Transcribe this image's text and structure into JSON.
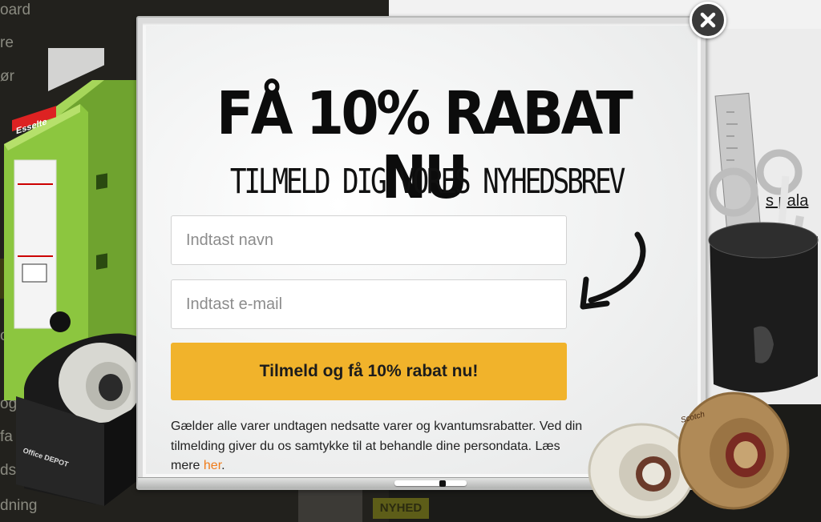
{
  "background": {
    "left_menu_items": [
      "oard",
      "re",
      "ør",
      "obb",
      "og",
      "fa",
      "ds",
      "dning"
    ],
    "right_link": "s pala",
    "badge": "NYHED"
  },
  "popup": {
    "headline": "FÅ 10% RABAT NU",
    "subheadline": "TILMELD DIG VORES NYHEDSBREV",
    "name_placeholder": "Indtast navn",
    "email_placeholder": "Indtast e-mail",
    "submit_label": "Tilmeld og få 10% rabat nu!",
    "disclaimer_text": "Gælder alle varer undtagen nedsatte varer og kvantumsrabatter. Ved din tilmelding giver du os samtykke til at behandle dine persondata. Læs mere ",
    "disclaimer_link": "her",
    "disclaimer_end": "."
  },
  "decor": {
    "binder_brand": "Esselte",
    "dispenser_brand": "Office DEPOT",
    "tape_brand": "Scotch"
  },
  "colors": {
    "button": "#f1b32b",
    "link": "#f07c1a",
    "close_bg": "#3a3a3a",
    "binder_green": "#8cc63f"
  },
  "icons": {
    "close": "close-icon",
    "arrow": "curved-arrow-icon"
  }
}
